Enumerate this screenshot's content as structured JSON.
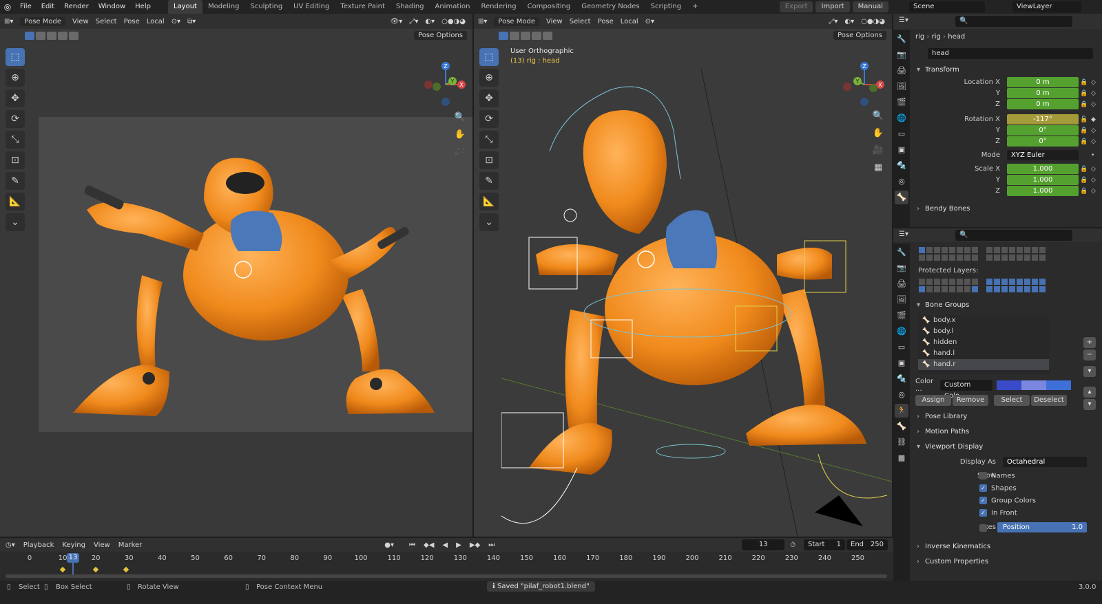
{
  "topbar": {
    "menus": [
      "File",
      "Edit",
      "Render",
      "Window",
      "Help"
    ],
    "workspaces": [
      "Layout",
      "Modeling",
      "Sculpting",
      "UV Editing",
      "Texture Paint",
      "Shading",
      "Animation",
      "Rendering",
      "Compositing",
      "Geometry Nodes",
      "Scripting"
    ],
    "active_workspace": "Layout",
    "export_label": "Export",
    "import_label": "Import",
    "manual_label": "Manual",
    "scene_value": "Scene",
    "viewlayer_value": "ViewLayer"
  },
  "left_viewport": {
    "mode": "Pose Mode",
    "menus": [
      "View",
      "Select",
      "Pose"
    ],
    "orientation": "Local",
    "pose_options": "Pose Options"
  },
  "right_viewport": {
    "mode": "Pose Mode",
    "menus": [
      "View",
      "Select",
      "Pose"
    ],
    "orientation": "Local",
    "pose_options": "Pose Options",
    "view_name": "User Orthographic",
    "object_info": "(13) rig : head"
  },
  "properties_top": {
    "breadcrumb": [
      "rig",
      "rig",
      "head"
    ],
    "bone_name": "head",
    "transform_label": "Transform",
    "location": [
      {
        "label": "Location X",
        "value": "0 m"
      },
      {
        "label": "Y",
        "value": "0 m"
      },
      {
        "label": "Z",
        "value": "0 m"
      }
    ],
    "rotation": [
      {
        "label": "Rotation X",
        "value": "-117°"
      },
      {
        "label": "Y",
        "value": "0°"
      },
      {
        "label": "Z",
        "value": "0°"
      }
    ],
    "mode_label": "Mode",
    "mode_value": "XYZ Euler",
    "scale": [
      {
        "label": "Scale X",
        "value": "1.000"
      },
      {
        "label": "Y",
        "value": "1.000"
      },
      {
        "label": "Z",
        "value": "1.000"
      }
    ],
    "bendy_bones": "Bendy Bones"
  },
  "properties_bottom": {
    "protected_layers": "Protected Layers:",
    "bone_groups_label": "Bone Groups",
    "bone_groups": [
      "body.x",
      "body.l",
      "hidden",
      "hand.l",
      "hand.r"
    ],
    "selected_group": "hand.r",
    "color_label": "Color ...",
    "color_value": "Custom Colo...",
    "color_swatches": [
      "#3a4bc9",
      "#7a86e0",
      "#3f6fd8"
    ],
    "assign": "Assign",
    "remove": "Remove",
    "select": "Select",
    "deselect": "Deselect",
    "pose_library": "Pose Library",
    "motion_paths": "Motion Paths",
    "viewport_display": "Viewport Display",
    "display_as_label": "Display As",
    "display_as_value": "Octahedral",
    "show_label": "Show",
    "show_items": [
      {
        "label": "Names",
        "checked": false
      },
      {
        "label": "Shapes",
        "checked": true
      },
      {
        "label": "Group Colors",
        "checked": true
      },
      {
        "label": "In Front",
        "checked": true
      }
    ],
    "axes_label": "Axes",
    "position_label": "Position",
    "position_value": "1.0",
    "inverse_kinematics": "Inverse Kinematics",
    "custom_properties": "Custom Properties"
  },
  "timeline": {
    "menus": [
      "Playback",
      "Keying",
      "View",
      "Marker"
    ],
    "current_frame": "13",
    "start_label": "Start",
    "start_value": "1",
    "end_label": "End",
    "end_value": "250",
    "ticks": [
      "0",
      "10",
      "20",
      "30",
      "40",
      "50",
      "60",
      "70",
      "80",
      "90",
      "100",
      "110",
      "120",
      "130",
      "140",
      "150",
      "160",
      "170",
      "180",
      "190",
      "200",
      "210",
      "220",
      "230",
      "240",
      "250"
    ]
  },
  "statusbar": {
    "select": "Select",
    "box_select": "Box Select",
    "rotate_view": "Rotate View",
    "pose_context": "Pose Context Menu",
    "saved_message": "Saved \"pilaf_robot1.blend\"",
    "version": "3.0.0"
  },
  "colors": {
    "accent": "#4772b3",
    "green_field": "#55a130",
    "yellow_field": "#a59a39",
    "robot_orange": "#f08a1c"
  }
}
